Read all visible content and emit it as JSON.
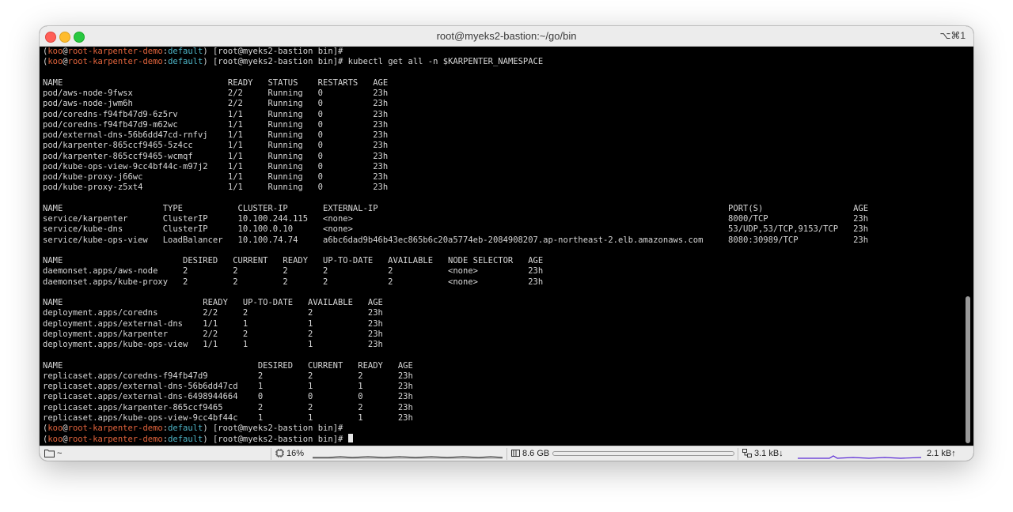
{
  "window": {
    "title": "root@myeks2-bastion:~/go/bin",
    "shortcut": "⌥⌘1"
  },
  "prompt": {
    "user": "koo",
    "host": "root-karpenter-demo",
    "namespace": "default",
    "suffix": "[root@myeks2-bastion bin]#"
  },
  "terminal": {
    "command": "kubectl get all -n $KARPENTER_NAMESPACE",
    "pods": {
      "header": [
        "NAME",
        "READY",
        "STATUS",
        "RESTARTS",
        "AGE"
      ],
      "rows": [
        [
          "pod/aws-node-9fwsx",
          "2/2",
          "Running",
          "0",
          "23h"
        ],
        [
          "pod/aws-node-jwm6h",
          "2/2",
          "Running",
          "0",
          "23h"
        ],
        [
          "pod/coredns-f94fb47d9-6z5rv",
          "1/1",
          "Running",
          "0",
          "23h"
        ],
        [
          "pod/coredns-f94fb47d9-m62wc",
          "1/1",
          "Running",
          "0",
          "23h"
        ],
        [
          "pod/external-dns-56b6dd47cd-rnfvj",
          "1/1",
          "Running",
          "0",
          "23h"
        ],
        [
          "pod/karpenter-865ccf9465-5z4cc",
          "1/1",
          "Running",
          "0",
          "23h"
        ],
        [
          "pod/karpenter-865ccf9465-wcmqf",
          "1/1",
          "Running",
          "0",
          "23h"
        ],
        [
          "pod/kube-ops-view-9cc4bf44c-m97j2",
          "1/1",
          "Running",
          "0",
          "23h"
        ],
        [
          "pod/kube-proxy-j66wc",
          "1/1",
          "Running",
          "0",
          "23h"
        ],
        [
          "pod/kube-proxy-z5xt4",
          "1/1",
          "Running",
          "0",
          "23h"
        ]
      ]
    },
    "services": {
      "header": [
        "NAME",
        "TYPE",
        "CLUSTER-IP",
        "EXTERNAL-IP",
        "PORT(S)",
        "AGE"
      ],
      "rows": [
        [
          "service/karpenter",
          "ClusterIP",
          "10.100.244.115",
          "<none>",
          "8000/TCP",
          "23h"
        ],
        [
          "service/kube-dns",
          "ClusterIP",
          "10.100.0.10",
          "<none>",
          "53/UDP,53/TCP,9153/TCP",
          "23h"
        ],
        [
          "service/kube-ops-view",
          "LoadBalancer",
          "10.100.74.74",
          "a6bc6dad9b46b43ec865b6c20a5774eb-2084908207.ap-northeast-2.elb.amazonaws.com",
          "8080:30989/TCP",
          "23h"
        ]
      ]
    },
    "daemonsets": {
      "header": [
        "NAME",
        "DESIRED",
        "CURRENT",
        "READY",
        "UP-TO-DATE",
        "AVAILABLE",
        "NODE SELECTOR",
        "AGE"
      ],
      "rows": [
        [
          "daemonset.apps/aws-node",
          "2",
          "2",
          "2",
          "2",
          "2",
          "<none>",
          "23h"
        ],
        [
          "daemonset.apps/kube-proxy",
          "2",
          "2",
          "2",
          "2",
          "2",
          "<none>",
          "23h"
        ]
      ]
    },
    "deployments": {
      "header": [
        "NAME",
        "READY",
        "UP-TO-DATE",
        "AVAILABLE",
        "AGE"
      ],
      "rows": [
        [
          "deployment.apps/coredns",
          "2/2",
          "2",
          "2",
          "23h"
        ],
        [
          "deployment.apps/external-dns",
          "1/1",
          "1",
          "1",
          "23h"
        ],
        [
          "deployment.apps/karpenter",
          "2/2",
          "2",
          "2",
          "23h"
        ],
        [
          "deployment.apps/kube-ops-view",
          "1/1",
          "1",
          "1",
          "23h"
        ]
      ]
    },
    "replicasets": {
      "header": [
        "NAME",
        "DESIRED",
        "CURRENT",
        "READY",
        "AGE"
      ],
      "rows": [
        [
          "replicaset.apps/coredns-f94fb47d9",
          "2",
          "2",
          "2",
          "23h"
        ],
        [
          "replicaset.apps/external-dns-56b6dd47cd",
          "1",
          "1",
          "1",
          "23h"
        ],
        [
          "replicaset.apps/external-dns-6498944664",
          "0",
          "0",
          "0",
          "23h"
        ],
        [
          "replicaset.apps/karpenter-865ccf9465",
          "2",
          "2",
          "2",
          "23h"
        ],
        [
          "replicaset.apps/kube-ops-view-9cc4bf44c",
          "1",
          "1",
          "1",
          "23h"
        ]
      ]
    }
  },
  "statusbar": {
    "folder_icon": "folder-icon",
    "path": "~",
    "cpu_icon": "cpu-icon",
    "cpu": "16%",
    "memory_icon": "memory-icon",
    "memory": "8.6 GB",
    "network_icon": "network-icon",
    "net_down": "3.1 kB↓",
    "net_up": "2.1 kB↑",
    "colors": {
      "cpu_graph": "#444444",
      "net_graph": "#5b2bd6"
    }
  }
}
